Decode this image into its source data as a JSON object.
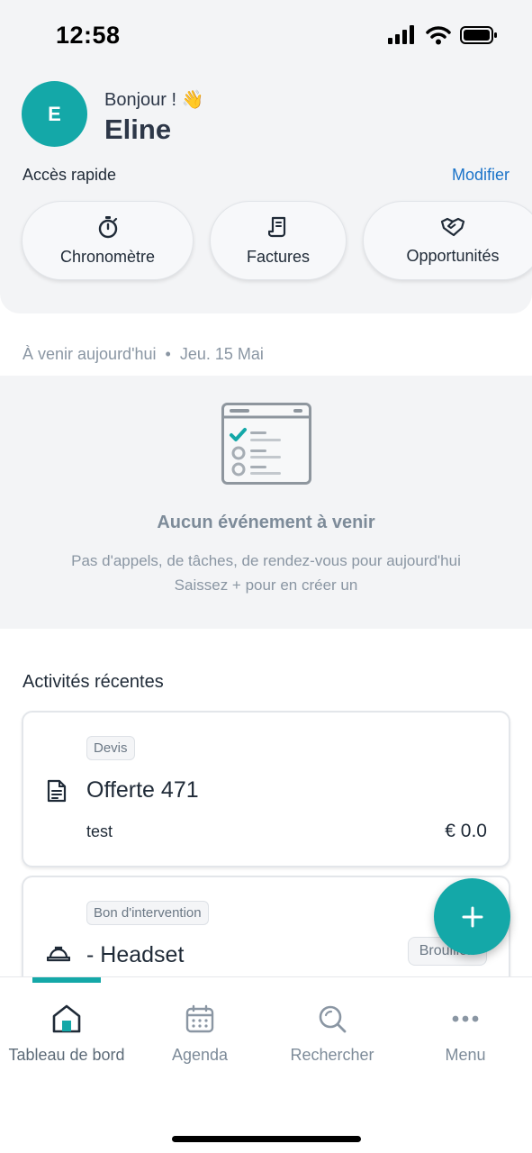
{
  "status_bar": {
    "time": "12:58"
  },
  "header": {
    "avatar_initial": "E",
    "greeting": "Bonjour ! 👋",
    "user_name": "Eline",
    "quick_access_title": "Accès rapide",
    "quick_access_edit": "Modifier",
    "quick_actions": [
      {
        "label": "Chronomètre",
        "icon": "stopwatch-icon"
      },
      {
        "label": "Factures",
        "icon": "invoice-icon"
      },
      {
        "label": "Opportunités",
        "icon": "handshake-icon"
      }
    ]
  },
  "upcoming": {
    "title": "À venir aujourd'hui",
    "separator": "•",
    "date": "Jeu. 15 Mai",
    "empty_title": "Aucun événement à venir",
    "empty_text_line1": "Pas d'appels, de tâches, de rendez-vous pour aujourd'hui",
    "empty_text_line2": "Saissez + pour en créer un"
  },
  "recent": {
    "title": "Activités récentes",
    "items": [
      {
        "tag": "Devis",
        "icon": "document-icon",
        "title": "Offerte 471",
        "subtitle": "test",
        "amount": "€ 0.0"
      },
      {
        "tag": "Bon d'intervention",
        "icon": "hard-hat-icon",
        "title": "- Headset",
        "status": "Brouillon"
      }
    ]
  },
  "fab": {
    "icon": "plus-icon"
  },
  "tabbar": {
    "items": [
      {
        "label": "Tableau de bord",
        "icon": "home-icon",
        "active": true
      },
      {
        "label": "Agenda",
        "icon": "calendar-icon",
        "active": false
      },
      {
        "label": "Rechercher",
        "icon": "search-icon",
        "active": false
      },
      {
        "label": "Menu",
        "icon": "more-icon",
        "active": false
      }
    ]
  },
  "colors": {
    "accent": "#14a8a8",
    "link": "#1a73c9",
    "panel": "#f3f4f6",
    "muted_text": "#8a96a3"
  }
}
